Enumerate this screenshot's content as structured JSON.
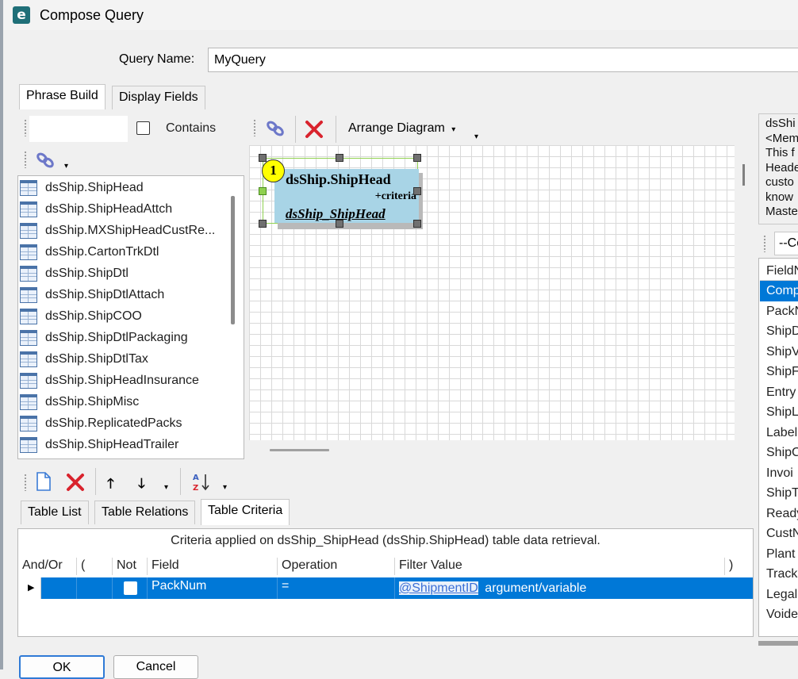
{
  "window": {
    "title": "Compose Query",
    "app_icon": "e-icon"
  },
  "query_name": {
    "label": "Query Name:",
    "value": "MyQuery"
  },
  "top_tabs": [
    {
      "label": "Phrase Build"
    },
    {
      "label": "Display Fields"
    }
  ],
  "left_panel": {
    "search_value": "",
    "contains_label": "Contains",
    "tables": [
      "dsShip.ShipHead",
      "dsShip.ShipHeadAttch",
      "dsShip.MXShipHeadCustRe...",
      "dsShip.CartonTrkDtl",
      "dsShip.ShipDtl",
      "dsShip.ShipDtlAttach",
      "dsShip.ShipCOO",
      "dsShip.ShipDtlPackaging",
      "dsShip.ShipDtlTax",
      "dsShip.ShipHeadInsurance",
      "dsShip.ShipMisc",
      "dsShip.ReplicatedPacks",
      "dsShip.ShipHeadTrailer"
    ]
  },
  "diagram_toolbar": {
    "arrange_label": "Arrange Diagram"
  },
  "diagram_node": {
    "badge": "1",
    "title": "dsShip.ShipHead",
    "criteria": "+criteria",
    "alias": "dsShip_ShipHead"
  },
  "bottom_tabs": [
    {
      "label": "Table List"
    },
    {
      "label": "Table Relations"
    },
    {
      "label": "Table Criteria"
    }
  ],
  "criteria": {
    "caption": "Criteria applied on dsShip_ShipHead (dsShip.ShipHead)  table data retrieval.",
    "headers": {
      "andor": "And/Or",
      "lparen": "(",
      "not": "Not",
      "field": "Field",
      "operation": "Operation",
      "filter_value": "Filter Value",
      "rparen": ")"
    },
    "rows": [
      {
        "field": "PackNum",
        "operation": "=",
        "filter_link": "@ShipmentID",
        "filter_text": "argument/variable"
      }
    ]
  },
  "buttons": {
    "ok": "OK",
    "cancel": "Cancel"
  },
  "right_panel": {
    "description": [
      "dsShi",
      "<Mem",
      "This f",
      "Heade",
      "custo",
      "know",
      "Maste"
    ],
    "dropdown": "--Co",
    "field_header": "FieldN",
    "fields": [
      "Comp",
      "PackN",
      "ShipD",
      "ShipV",
      "ShipF",
      "Entry",
      "ShipL",
      "Label",
      "ShipC",
      "Invoi",
      "ShipT",
      "Ready",
      "CustN",
      "Plant",
      "Track",
      "Legal",
      "Voide"
    ]
  },
  "colors": {
    "selection": "#0078d7",
    "node_fill": "#a8d4e6",
    "badge": "#ffff00",
    "delete_red": "#d9232d",
    "link": "#3b6fd6"
  }
}
